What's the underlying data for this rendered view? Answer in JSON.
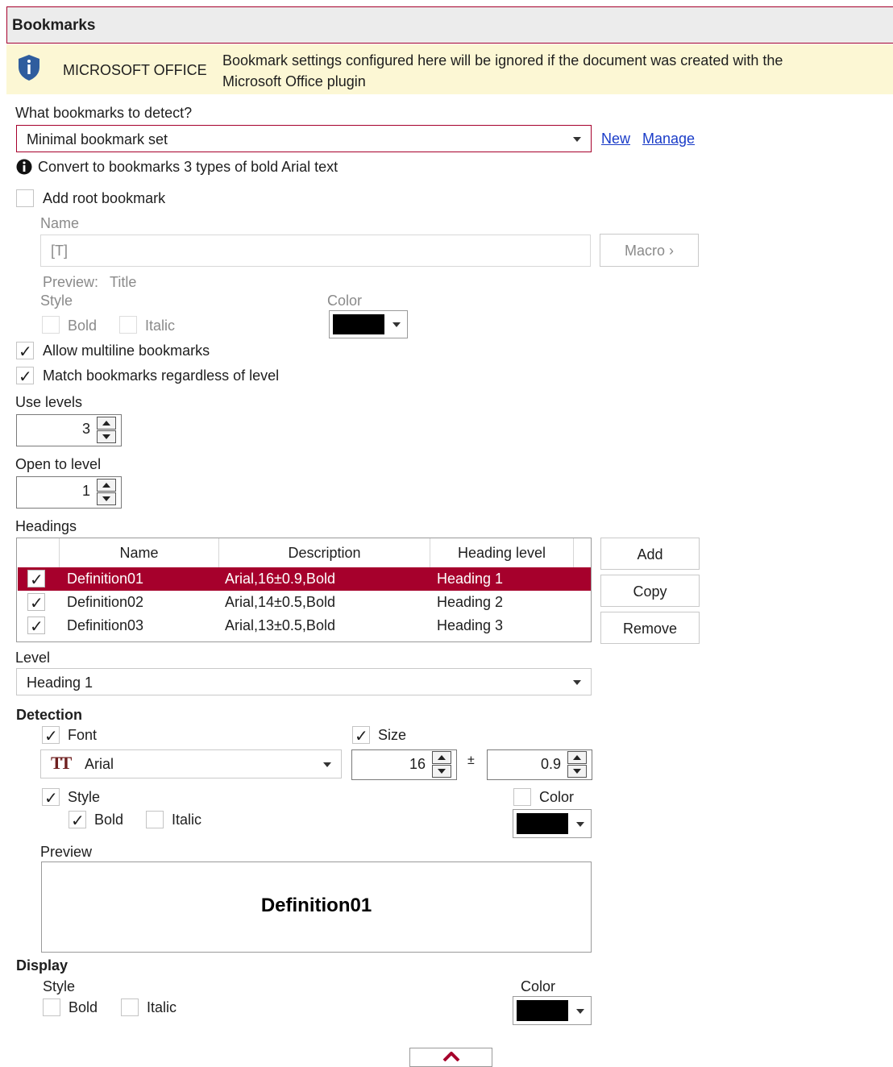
{
  "header": {
    "title": "Bookmarks"
  },
  "banner": {
    "icon": "shield-info-icon",
    "product": "MICROSOFT OFFICE",
    "message_line1": "Bookmark settings configured here will be ignored if the document was created with the",
    "message_line2": "Microsoft Office plugin"
  },
  "detect": {
    "label": "What bookmarks to detect?",
    "value": "Minimal bookmark set",
    "new_link": "New",
    "manage_link": "Manage",
    "info": "Convert to bookmarks 3 types of bold Arial text"
  },
  "root": {
    "add_label": "Add root bookmark",
    "add_checked": false,
    "name_label": "Name",
    "name_value": "[T]",
    "macro_button": "Macro ›",
    "preview_label": "Preview:",
    "preview_value": "Title",
    "style_label": "Style",
    "bold_label": "Bold",
    "italic_label": "Italic",
    "color_label": "Color",
    "color_value": "#000000"
  },
  "options": {
    "multiline_label": "Allow multiline bookmarks",
    "multiline_checked": true,
    "regardless_label": "Match bookmarks regardless of level",
    "regardless_checked": true
  },
  "levels": {
    "use_label": "Use levels",
    "use_value": "3",
    "open_label": "Open to level",
    "open_value": "1"
  },
  "headings": {
    "label": "Headings",
    "columns": [
      "Name",
      "Description",
      "Heading level"
    ],
    "rows": [
      {
        "checked": true,
        "name": "Definition01",
        "description": "Arial,16±0.9,Bold",
        "level": "Heading 1",
        "selected": true
      },
      {
        "checked": true,
        "name": "Definition02",
        "description": "Arial,14±0.5,Bold",
        "level": "Heading 2",
        "selected": false
      },
      {
        "checked": true,
        "name": "Definition03",
        "description": "Arial,13±0.5,Bold",
        "level": "Heading 3",
        "selected": false
      }
    ],
    "add_button": "Add",
    "copy_button": "Copy",
    "remove_button": "Remove"
  },
  "level": {
    "label": "Level",
    "value": "Heading 1"
  },
  "detection": {
    "title": "Detection",
    "font_label": "Font",
    "font_checked": true,
    "font_value": "Arial",
    "font_icon": "font-tt-icon",
    "size_label": "Size",
    "size_checked": true,
    "size_value": "16",
    "plusminus": "±",
    "tolerance_value": "0.9",
    "style_label": "Style",
    "style_checked": true,
    "bold_label": "Bold",
    "bold_checked": true,
    "italic_label": "Italic",
    "italic_checked": false,
    "color_label": "Color",
    "color_checked": false,
    "color_value": "#000000",
    "preview_label": "Preview",
    "preview_text": "Definition01"
  },
  "display": {
    "title": "Display",
    "style_label": "Style",
    "bold_label": "Bold",
    "italic_label": "Italic",
    "color_label": "Color",
    "color_value": "#000000"
  },
  "accent": "#a6002c"
}
